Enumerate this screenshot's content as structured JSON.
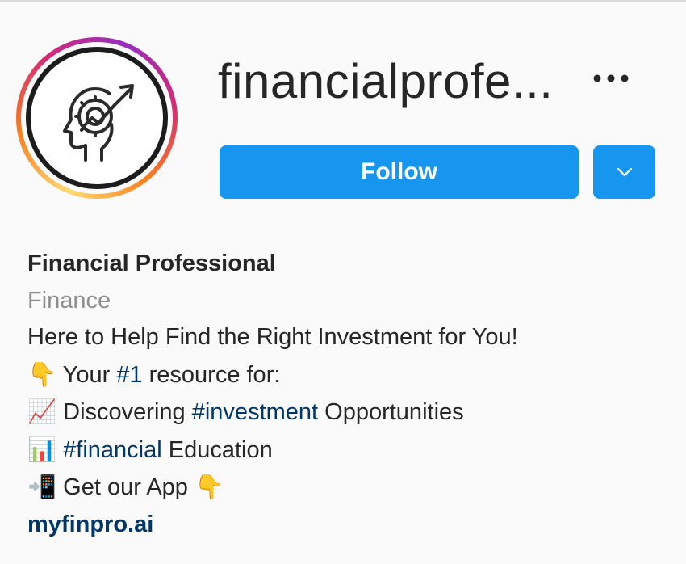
{
  "profile": {
    "username": "financialprofe...",
    "follow_label": "Follow",
    "full_name": "Financial Professional",
    "category": "Finance",
    "bio_lines": {
      "tagline": "Here to Help Find the Right Investment for You!",
      "line2": {
        "emoji": "👇",
        "pre": " Your ",
        "hashtag": "#1",
        "post": " resource for:"
      },
      "line3": {
        "emoji": "📈",
        "pre": " Discovering ",
        "hashtag": "#investment",
        "post": " Opportunities"
      },
      "line4": {
        "emoji": "📊",
        "pre": " ",
        "hashtag": "#financial",
        "post": " Education"
      },
      "line5": {
        "emoji": "📲",
        "text": " Get our App ",
        "emoji_end": "👇"
      }
    },
    "website": "myfinpro.ai"
  },
  "icons": {
    "avatar": "head-growth-arrow-icon",
    "more": "more-options-icon",
    "dropdown": "chevron-down-icon"
  },
  "colors": {
    "follow_button": "#1796f0",
    "link": "#00376b",
    "category": "#8e8e8e",
    "text": "#262626"
  }
}
